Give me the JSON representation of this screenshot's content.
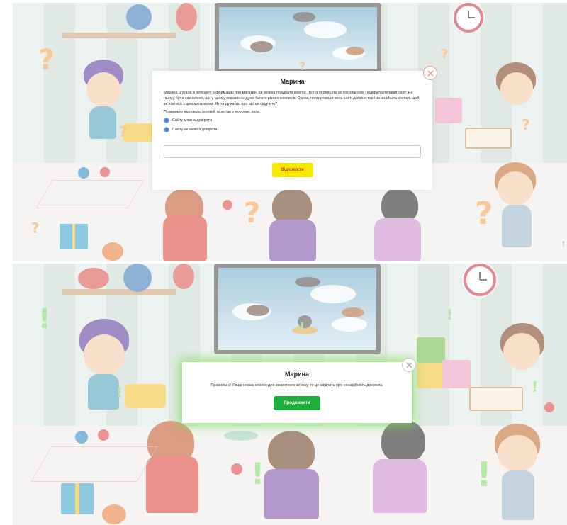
{
  "question_screen": {
    "dialog": {
      "title": "Марина",
      "body": "Марина шукала в інтернеті інформацію про магазин, де можна придбати компас. Вона перейшла за посиланням і відкрила перший сайт. На ньому було зазначено, що у цьому магазині є дуже багато різних компасів. Однак, прогортавши весь сайт, дівчина так і не знайшла кнопки, щоб зв'язатися з цим магазином. Як ти думаєш, про що це свідчить?",
      "hint": "Правильну відповідь скопіюй та встав у порожнє поле.",
      "options": [
        {
          "label": "Сайту можна довіряти."
        },
        {
          "label": "Сайту не можна довіряти."
        }
      ],
      "input_value": "",
      "submit_label": "Відповісти",
      "close_icon": "close-icon"
    },
    "decor_marks": [
      "?",
      "?",
      "?",
      "?",
      "?",
      "?",
      "?",
      "?"
    ]
  },
  "feedback_screen": {
    "dialog": {
      "title": "Марина",
      "message": "Правильно! Якщо немає кнопок для зворотного зв'язку, то це свідчить про ненадійність джерела.",
      "continue_label": "Продовжити",
      "close_icon": "close-icon"
    },
    "decor_marks": [
      "!",
      "!",
      "!",
      "!",
      "!",
      "!",
      "!"
    ]
  },
  "colors": {
    "submit_bg": "#f7e800",
    "submit_text": "#c13e2e",
    "continue_bg": "#1fad3d",
    "correct_glow": "#78dc5a",
    "radio": "#4a80e0"
  }
}
